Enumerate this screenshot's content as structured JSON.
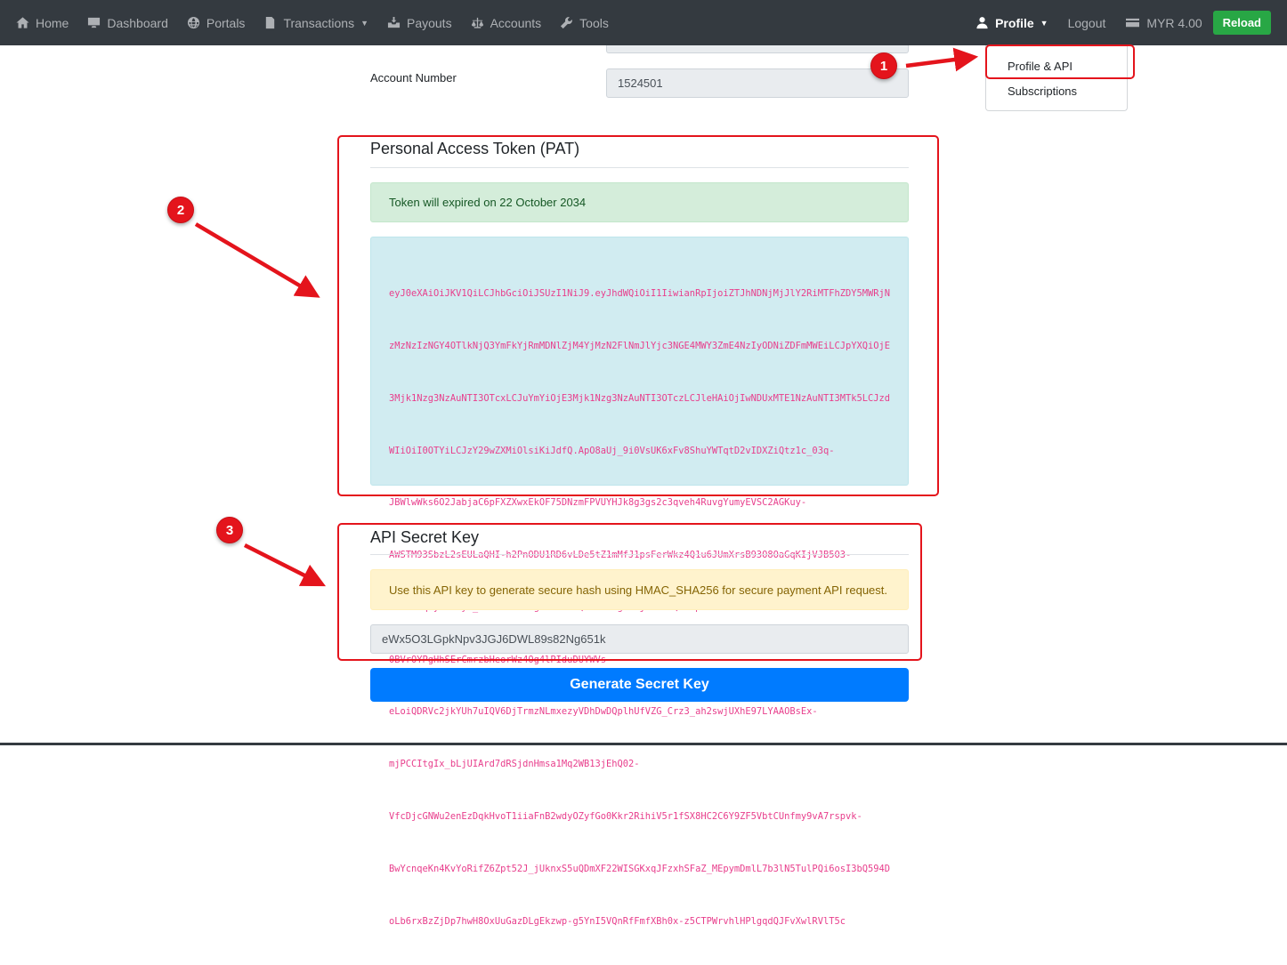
{
  "navbar": {
    "left_items": [
      {
        "label": "Home",
        "icon": "home-icon"
      },
      {
        "label": "Dashboard",
        "icon": "monitor-icon"
      },
      {
        "label": "Portals",
        "icon": "globe-icon"
      },
      {
        "label": "Transactions",
        "icon": "document-icon",
        "has_caret": true
      },
      {
        "label": "Payouts",
        "icon": "inbox-icon"
      },
      {
        "label": "Accounts",
        "icon": "balance-scale-icon"
      },
      {
        "label": "Tools",
        "icon": "wrench-icon"
      }
    ],
    "profile_label": "Profile",
    "logout_label": "Logout",
    "balance_label": "MYR 4.00",
    "reload_label": "Reload"
  },
  "profile_menu": {
    "items": [
      "Profile & API",
      "Subscriptions"
    ]
  },
  "account": {
    "label": "Account Number",
    "value": "1524501"
  },
  "pat": {
    "title": "Personal Access Token (PAT)",
    "expiry_notice": "Token will expired on 22 October 2034",
    "token_lines": [
      "eyJ0eXAiOiJKV1QiLCJhbGciOiJSUzI1NiJ9.eyJhdWQiOiI1IiwianRpIjoiZTJhNDNjMjJlY2RiMTFhZDY5MWRjN",
      "zMzNzIzNGY4OTlkNjQ3YmFkYjRmMDNlZjM4YjMzN2FlNmJlYjc3NGE4MWY3ZmE4NzIyODNiZDFmMWEiLCJpYXQiOjE",
      "3Mjk1Nzg3NzAuNTI3OTcxLCJuYmYiOjE3Mjk1Nzg3NzAuNTI3OTczLCJleHAiOjIwNDUxMTE1NzAuNTI3MTk5LCJzd",
      "WIiOiI0OTYiLCJzY29wZXMiOlsiKiJdfQ.ApO8aUj_9i0VsUK6xFv8ShuYWTqtD2vIDXZiQtz1c_03q-",
      "JBWlwWks6O2JabjaC6pFXZXwxEkOF75DNzmFPVUYHJk8g3gs2c3qveh4RuvgYumyEVSC2AGKuy-",
      "AWSTM93SbzL2sEULaQHI-h2PnODU1RD6vLDe5tZ1mMfJ1psFerWkz4Q1u6JUmXrsB93O8OaGqKIjVJB5O3-",
      "CCe6JtqhyYku-yr_Suea2aerE-gWE1RSrBQfoTYt0g8mkjUYJFLQccIpnN1-",
      "0BVrOYPgHhSErCmrzbHeorWz4Og4lPIduDUYWVs-",
      "eLoiQDRVc2jkYUh7uIQV6DjTrmzNLmxezyVDhDwDQplhUfVZG_Crz3_ah2swjUXhE97LYAAOBsEx-",
      "mjPCCItgIx_bLjUIArd7dRSjdnHmsa1Mq2WB13jEhQ02-",
      "VfcDjcGNWu2enEzDqkHvoT1iiaFnB2wdyOZyfGo0Kkr2RihiV5r1fSX8HC2C6Y9ZF5VbtCUnfmy9vA7rspvk-",
      "BwYcnqeKn4KvYoRifZ6Zpt52J_jUknxS5uQDmXF22WISGKxqJFzxhSFaZ_MEpymDmlL7b3lN5TulPQi6osI3bQ594D",
      "oLb6rxBzZjDp7hwH8OxUuGazDLgEkzwp-g5YnI5VQnRfFmfXBh0x-z5CTPWrvhlHPlgqdQJFvXwlRVlT5c"
    ]
  },
  "api_secret": {
    "title": "API Secret Key",
    "notice": "Use this API key to generate secure hash using HMAC_SHA256 for secure payment API request.",
    "value": "eWx5O3LGpkNpv3JGJ6DWL89s82Ng651k",
    "generate_label": "Generate Secret Key"
  },
  "annotations": {
    "badges": [
      "1",
      "2",
      "3"
    ],
    "color": "#e4141c"
  },
  "colors": {
    "navbar": "#343a40",
    "primary": "#007bff",
    "success": "#28a745",
    "token_text": "#e83e8c"
  }
}
